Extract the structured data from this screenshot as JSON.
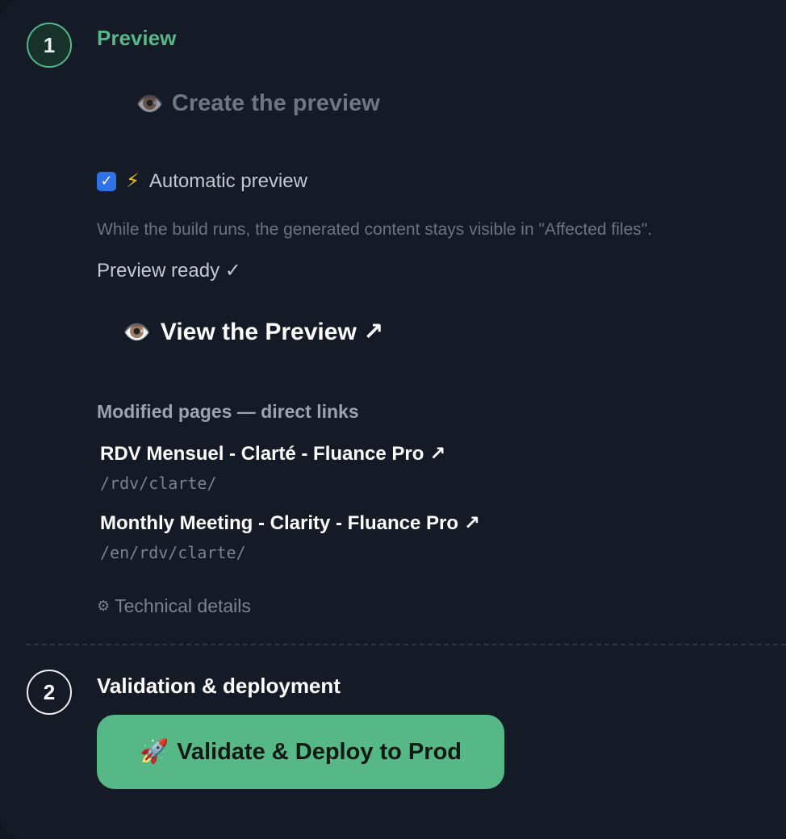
{
  "step1": {
    "number": "1",
    "title": "Preview",
    "create_button_icon": "👁️",
    "create_button_label": "Create the preview",
    "auto_preview_checked": true,
    "auto_preview_check_glyph": "✓",
    "auto_preview_icon": "⚡",
    "auto_preview_label": "Automatic preview",
    "help_text": "While the build runs, the generated content stays visible in \"Affected files\".",
    "status_text": "Preview ready ✓",
    "view_link_icon": "👁️",
    "view_link_label": "View the Preview ↗",
    "modified_pages_label": "Modified pages — direct links",
    "pages": [
      {
        "title": "RDV Mensuel - Clarté - Fluance Pro ↗",
        "path": "/rdv/clarte/"
      },
      {
        "title": "Monthly Meeting - Clarity - Fluance Pro ↗",
        "path": "/en/rdv/clarte/"
      }
    ],
    "technical_details_icon": "⚙",
    "technical_details_label": "Technical details"
  },
  "step2": {
    "number": "2",
    "title": "Validation & deployment",
    "deploy_button_icon": "🚀",
    "deploy_button_label": "Validate & Deploy to Prod"
  },
  "colors": {
    "background": "#151a27",
    "accent_green": "#56b886",
    "checkbox_blue": "#2f72e8"
  }
}
